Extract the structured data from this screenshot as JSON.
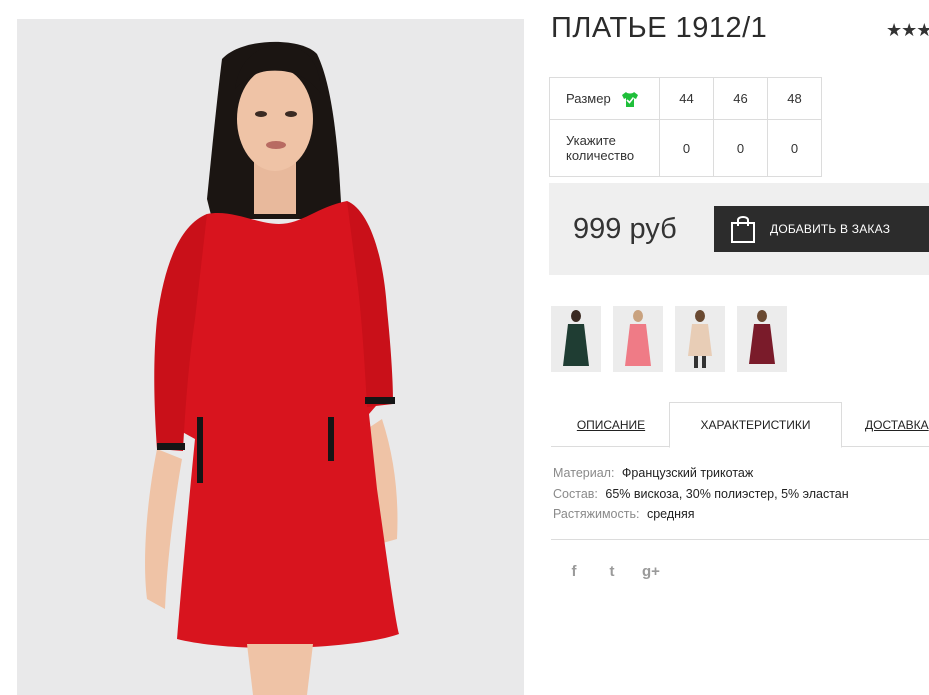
{
  "product": {
    "title": "ПЛАТЬЕ 1912/1",
    "rating_stars": "★★★"
  },
  "size_table": {
    "size_label": "Размер",
    "quantity_label_line1": "Укажите",
    "quantity_label_line2": "количество",
    "sizes": [
      "44",
      "46",
      "48"
    ],
    "quantities": [
      "0",
      "0",
      "0"
    ]
  },
  "purchase": {
    "price": "999 руб",
    "order_button": "ДОБАВИТЬ В ЗАКАЗ"
  },
  "thumbnails": [
    {
      "color": "#1f3d33"
    },
    {
      "color": "#ef7b86"
    },
    {
      "color": "#e8cdb6"
    },
    {
      "color": "#7a1b2a"
    }
  ],
  "tabs": [
    {
      "label": "ОПИСАНИЕ"
    },
    {
      "label": "ХАРАКТЕРИСТИКИ"
    },
    {
      "label": "ДОСТАВКА"
    }
  ],
  "characteristics": [
    {
      "key": "Материал:",
      "value": "Французский трикотаж"
    },
    {
      "key": "Состав:",
      "value": "65% вискоза, 30% полиэстер, 5% эластан"
    },
    {
      "key": "Растяжимость:",
      "value": "средняя"
    }
  ],
  "social": {
    "facebook": "f",
    "twitter": "t",
    "googleplus": "g+"
  },
  "colors": {
    "dress": "#d8141e",
    "button_bg": "#2c2c2c",
    "price_box_bg": "#efefef",
    "size_check": "#1fbf3a"
  }
}
